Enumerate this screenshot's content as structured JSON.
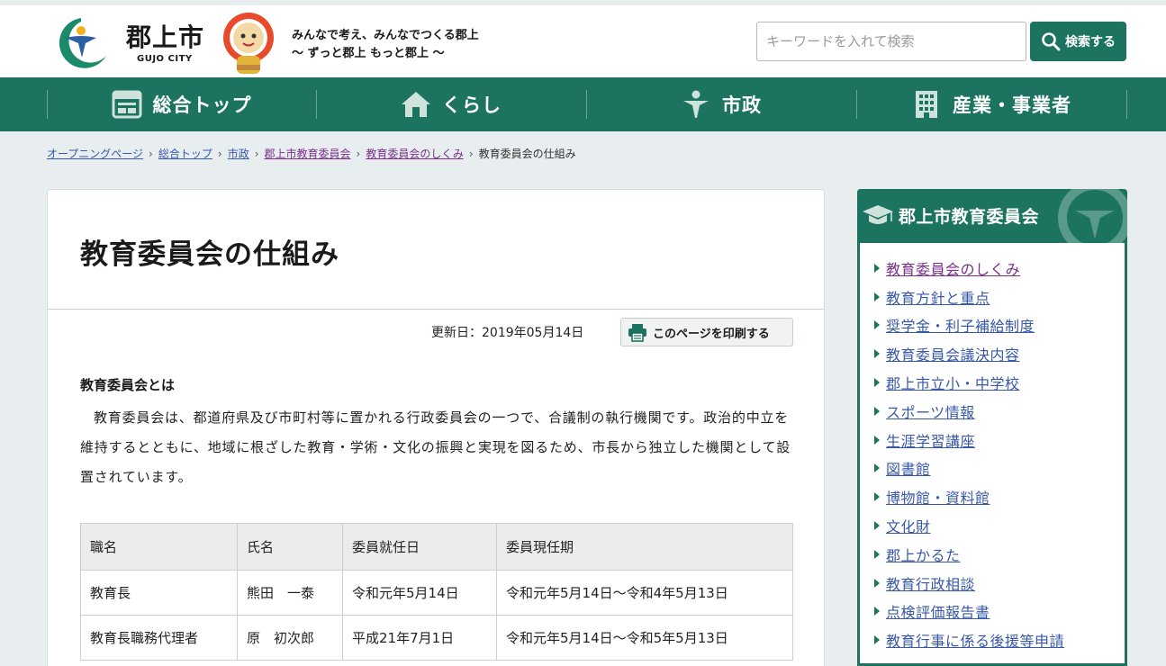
{
  "header": {
    "city_name": "郡上市",
    "city_name_en": "GUJO CITY",
    "tagline_line1": "みんなで考え、みんなでつくる郡上",
    "tagline_line2": "～ ずっと郡上 もっと郡上 ～",
    "search_placeholder": "キーワードを入れて検索",
    "search_button": "検索する"
  },
  "nav": {
    "items": [
      {
        "label": "総合トップ",
        "icon": "top-page-icon"
      },
      {
        "label": "くらし",
        "icon": "house-icon"
      },
      {
        "label": "市政",
        "icon": "person-icon"
      },
      {
        "label": "産業・事業者",
        "icon": "building-icon"
      }
    ]
  },
  "breadcrumb": {
    "items": [
      "オープニングページ",
      "総合トップ",
      "市政",
      "郡上市教育委員会",
      "教育委員会のしくみ"
    ],
    "current": "教育委員会の仕組み"
  },
  "main": {
    "title": "教育委員会の仕組み",
    "updated": "更新日：2019年05月14日",
    "print_button": "このページを印刷する",
    "section_heading": "教育委員会とは",
    "body": "教育委員会は、都道府県及び市町村等に置かれる行政委員会の一つで、合議制の執行機関です。政治的中立を維持するとともに、地域に根ざした教育・学術・文化の振興と実現を図るため、市長から独立した機関として設置されています。",
    "table": {
      "headers": [
        "職名",
        "氏名",
        "委員就任日",
        "委員現任期"
      ],
      "rows": [
        [
          "教育長",
          "熊田　一泰",
          "令和元年5月14日",
          "令和元年5月14日～令和4年5月13日"
        ],
        [
          "教育長職務代理者",
          "原　初次郎",
          "平成21年7月1日",
          "令和元年5月14日～令和5年5月13日"
        ]
      ]
    }
  },
  "sidebar": {
    "title": "郡上市教育委員会",
    "links": [
      "教育委員会のしくみ",
      "教育方針と重点",
      "奨学金・利子補給制度",
      "教育委員会議決内容",
      "郡上市立小・中学校",
      "スポーツ情報",
      "生涯学習講座",
      "図書館",
      "博物館・資料館",
      "文化財",
      "郡上かるた",
      "教育行政相談",
      "点検評価報告書",
      "教育行事に係る後援等申請"
    ]
  },
  "colors": {
    "brand_green": "#1b7360",
    "link_blue": "#3858a8",
    "link_visited": "#7a2f8c",
    "page_bg": "#e8eef0"
  }
}
